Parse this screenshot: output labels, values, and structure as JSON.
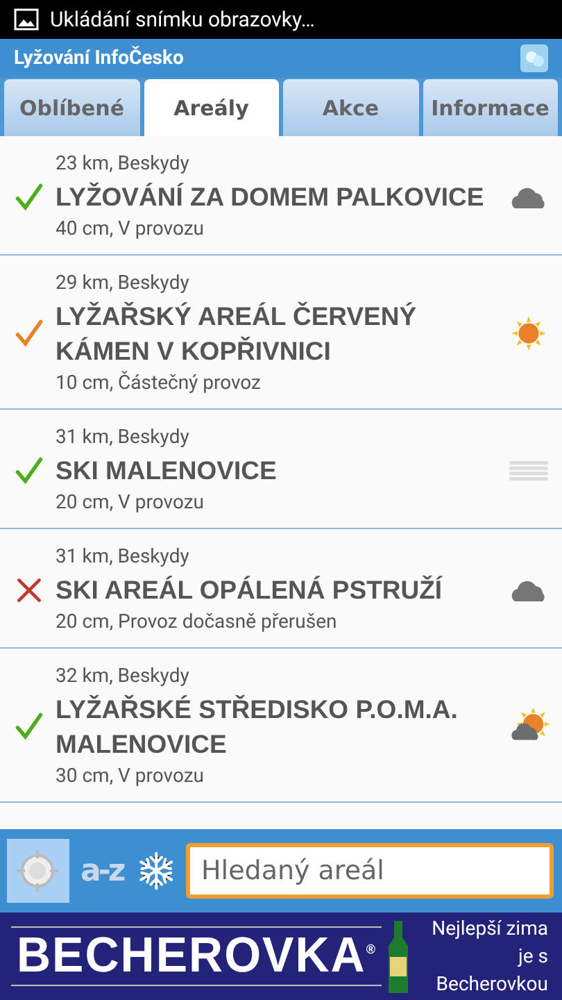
{
  "status_bar": {
    "notification": "Ukládání snímku obrazovky…"
  },
  "app_bar": {
    "title": "Lyžování InfoČesko"
  },
  "tabs": [
    {
      "label": "Oblíbené",
      "selected": false
    },
    {
      "label": "Areály",
      "selected": true
    },
    {
      "label": "Akce",
      "selected": false
    },
    {
      "label": "Informace",
      "selected": false
    }
  ],
  "resorts": [
    {
      "distance": "23 km, Beskydy",
      "name": "LYŽOVÁNÍ ZA DOMEM PALKOVICE",
      "snow": "40 cm, V provozu",
      "status": {
        "kind": "open"
      },
      "weather": {
        "kind": "cloud"
      }
    },
    {
      "distance": "29 km, Beskydy",
      "name": "LYŽAŘSKÝ AREÁL ČERVENÝ KÁMEN V KOPŘIVNICI",
      "snow": "10 cm, Částečný provoz",
      "status": {
        "kind": "partial"
      },
      "weather": {
        "kind": "sun"
      }
    },
    {
      "distance": "31 km, Beskydy",
      "name": "SKI MALENOVICE",
      "snow": "20 cm, V provozu",
      "status": {
        "kind": "open"
      },
      "weather": {
        "kind": "fog"
      }
    },
    {
      "distance": "31 km, Beskydy",
      "name": "SKI AREÁL OPÁLENÁ PSTRUŽÍ",
      "snow": "20 cm, Provoz dočasně přerušen",
      "status": {
        "kind": "closed"
      },
      "weather": {
        "kind": "cloud"
      }
    },
    {
      "distance": "32 km, Beskydy",
      "name": "LYŽAŘSKÉ STŘEDISKO P.O.M.A. MALENOVICE",
      "snow": "30 cm, V provozu",
      "status": {
        "kind": "open"
      },
      "weather": {
        "kind": "partly"
      }
    }
  ],
  "toolbar": {
    "sort_label": "a-z",
    "search": {
      "placeholder": "Hledaný areál"
    }
  },
  "ad": {
    "logo": "BECHEROVKA$^{®}$",
    "slogan": "Nejlepší zima je s Becherovkou"
  }
}
